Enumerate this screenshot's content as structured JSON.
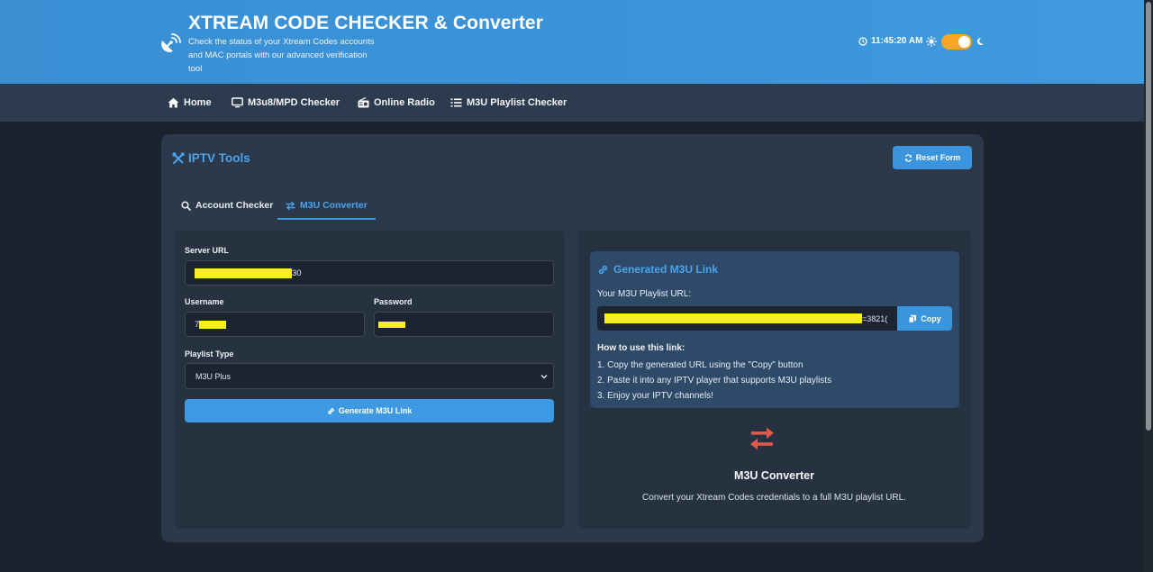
{
  "header": {
    "title": "XTREAM CODE CHECKER & Converter",
    "subtitle": "Check the status of your Xtream Codes accounts and MAC portals with our advanced verification tool",
    "time": "11:45:20 AM",
    "theme_toggle_on": true,
    "accent_color": "#f6a623"
  },
  "nav": {
    "items": [
      {
        "label": "Home",
        "icon": "home-icon"
      },
      {
        "label": "M3u8/MPD Checker",
        "icon": "monitor-icon"
      },
      {
        "label": "Online Radio",
        "icon": "radio-icon"
      },
      {
        "label": "M3U Playlist Checker",
        "icon": "list-icon"
      }
    ]
  },
  "card": {
    "title": "IPTV Tools",
    "reset_label": "Reset Form",
    "tabs": [
      {
        "label": "Account Checker",
        "icon": "search-icon",
        "active": false
      },
      {
        "label": "M3U Converter",
        "icon": "exchange-icon",
        "active": true
      }
    ]
  },
  "form": {
    "server_url_label": "Server URL",
    "server_url_value": "30",
    "username_label": "Username",
    "username_value": "7",
    "password_label": "Password",
    "playlist_type_label": "Playlist Type",
    "playlist_type_value": "M3U Plus",
    "generate_label": "Generate M3U Link"
  },
  "result": {
    "title": "Generated M3U Link",
    "url_label": "Your M3U Playlist URL:",
    "url_value": "=3821(",
    "copy_label": "Copy",
    "howto_title": "How to use this link:",
    "steps": [
      "1. Copy the generated URL using the \"Copy\" button",
      "2. Paste it into any IPTV player that supports M3U playlists",
      "3. Enjoy your IPTV channels!"
    ]
  },
  "converter_info": {
    "title": "M3U Converter",
    "description": "Convert your Xtream Codes credentials to a full M3U playlist URL.",
    "icon_color": "#e05a4a"
  }
}
